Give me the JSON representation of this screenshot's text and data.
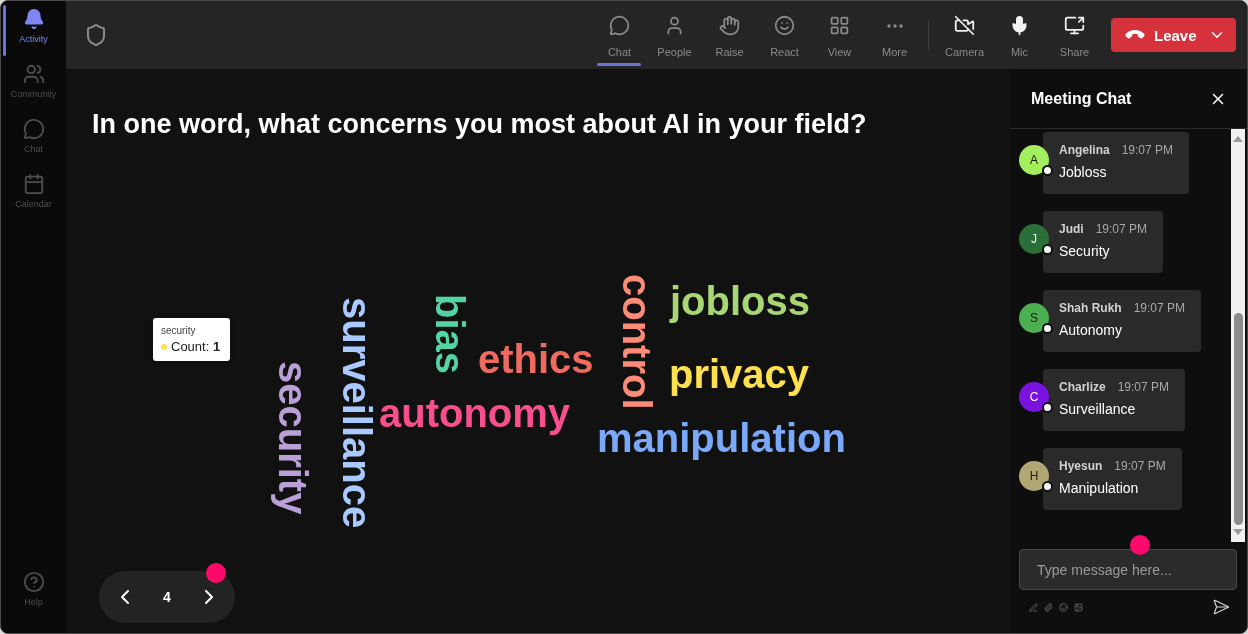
{
  "sidebar": {
    "items": [
      {
        "label": "Activity",
        "selected": true
      },
      {
        "label": "Community",
        "selected": false
      },
      {
        "label": "Chat",
        "selected": false
      },
      {
        "label": "Calendar",
        "selected": false
      }
    ],
    "help": {
      "label": "Help"
    }
  },
  "toolbar": {
    "actions": [
      {
        "label": "Chat",
        "selected": true
      },
      {
        "label": "People",
        "selected": false
      },
      {
        "label": "Raise",
        "selected": false
      },
      {
        "label": "React",
        "selected": false
      },
      {
        "label": "View",
        "selected": false
      },
      {
        "label": "More",
        "selected": false
      }
    ],
    "devices": [
      {
        "label": "Camera"
      },
      {
        "label": "Mic"
      },
      {
        "label": "Share"
      }
    ],
    "leave_button": {
      "label": "Leave"
    }
  },
  "question": {
    "title": "In one word, what concerns you most about AI in your field?"
  },
  "word_cloud": {
    "words": [
      {
        "text": "control",
        "color": "#fc8b77",
        "kind": "vertical"
      },
      {
        "text": "jobloss",
        "color": "#a8d672",
        "kind": "horizontal"
      },
      {
        "text": "bias",
        "color": "#55d4a3",
        "kind": "vertical"
      },
      {
        "text": "surveillance",
        "color": "#a9c9ff",
        "kind": "vertical"
      },
      {
        "text": "ethics",
        "color": "#ef6b5f",
        "kind": "horizontal"
      },
      {
        "text": "privacy",
        "color": "#ffe04f",
        "kind": "horizontal"
      },
      {
        "text": "security",
        "color": "#b9a0d6",
        "kind": "vertical"
      },
      {
        "text": "autonomy",
        "color": "#fa4f8e",
        "kind": "horizontal"
      },
      {
        "text": "manipulation",
        "color": "#79a9f8",
        "kind": "horizontal"
      }
    ],
    "tooltip": {
      "word": "security",
      "count": "Count: **1**"
    }
  },
  "pager": {
    "page": "4"
  },
  "chat": {
    "title": "Meeting Chat",
    "messages": [
      {
        "initial": "A",
        "color": "#a3ef5e",
        "name": "Angelina",
        "time": "19:07 PM",
        "text": "Jobloss"
      },
      {
        "initial": "J",
        "color": "#2a6e38",
        "name": "Judi",
        "time": "19:07 PM",
        "text": "Security"
      },
      {
        "initial": "S",
        "color": "#4caf50",
        "name": "Shah Rukh",
        "time": "19:07 PM",
        "text": "Autonomy"
      },
      {
        "initial": "C",
        "color": "#7a12e0",
        "name": "Charlize",
        "time": "19:07 PM",
        "text": "Surveillance"
      },
      {
        "initial": "H",
        "color": "#b0a874",
        "name": "Hyesun",
        "time": "19:07 PM",
        "text": "Manipulation"
      }
    ],
    "input": {
      "placeholder": "Type message here..."
    }
  }
}
